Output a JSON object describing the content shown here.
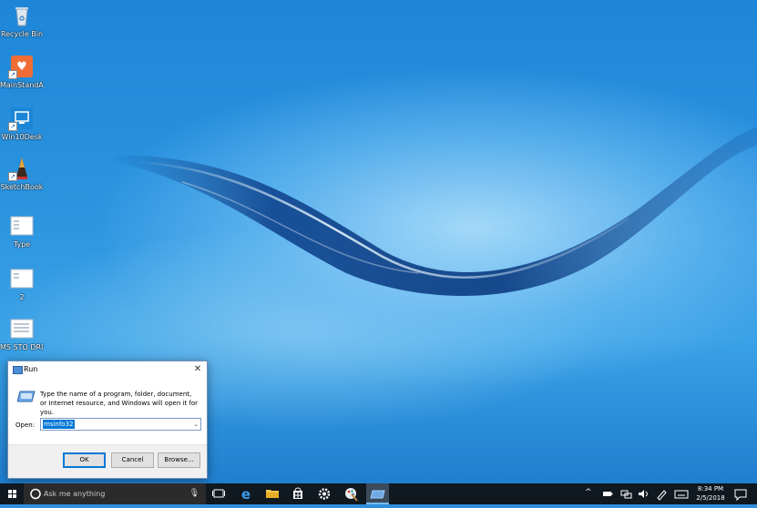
{
  "desktop": {
    "icons": [
      {
        "label": "Recycle Bin",
        "icon": "recycle-bin-icon"
      },
      {
        "label": "MainStandA...",
        "icon": "app-heart-icon"
      },
      {
        "label": "Win10Desk",
        "icon": "monitor-app-icon"
      },
      {
        "label": "SketchBook",
        "icon": "pencil-icon"
      },
      {
        "label": "Type",
        "icon": "document-icon"
      },
      {
        "label": "2",
        "icon": "document-icon"
      },
      {
        "label": "MS STO DRIVE",
        "icon": "document-icon"
      }
    ]
  },
  "run_dialog": {
    "title": "Run",
    "message": "Type the name of a program, folder, document, or Internet resource, and Windows will open it for you.",
    "open_label": "Open:",
    "open_value": "msinfo32",
    "ok_label": "OK",
    "cancel_label": "Cancel",
    "browse_label": "Browse..."
  },
  "taskbar": {
    "search_placeholder": "Ask me anything",
    "time": "8:34 PM",
    "date": "2/5/2018",
    "accent_color": "#0078d7"
  }
}
